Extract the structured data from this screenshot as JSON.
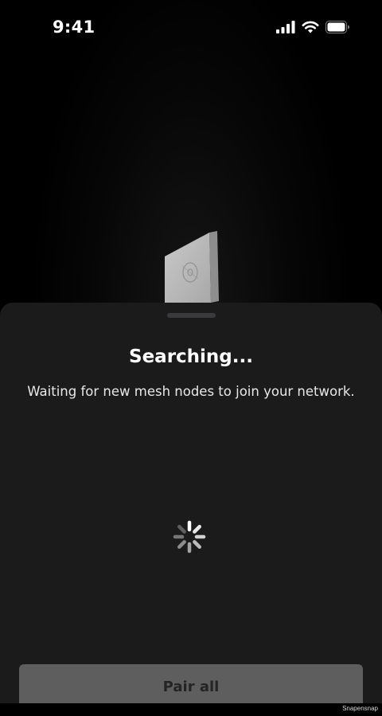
{
  "status_bar": {
    "time": "9:41",
    "icons": [
      "cellular-signal-icon",
      "wifi-icon",
      "battery-icon"
    ]
  },
  "device": {
    "icon": "mesh-node-device-icon"
  },
  "sheet": {
    "title": "Searching...",
    "subtitle": "Waiting for new mesh nodes to join your network.",
    "spinner_icon": "loading-spinner-icon",
    "primary_button_label": "Pair all"
  },
  "watermark": "Snapensnap",
  "colors": {
    "background": "#000000",
    "sheet": "#1b1b1c",
    "button_disabled": "#5e5e5e",
    "button_text": "#242424"
  }
}
